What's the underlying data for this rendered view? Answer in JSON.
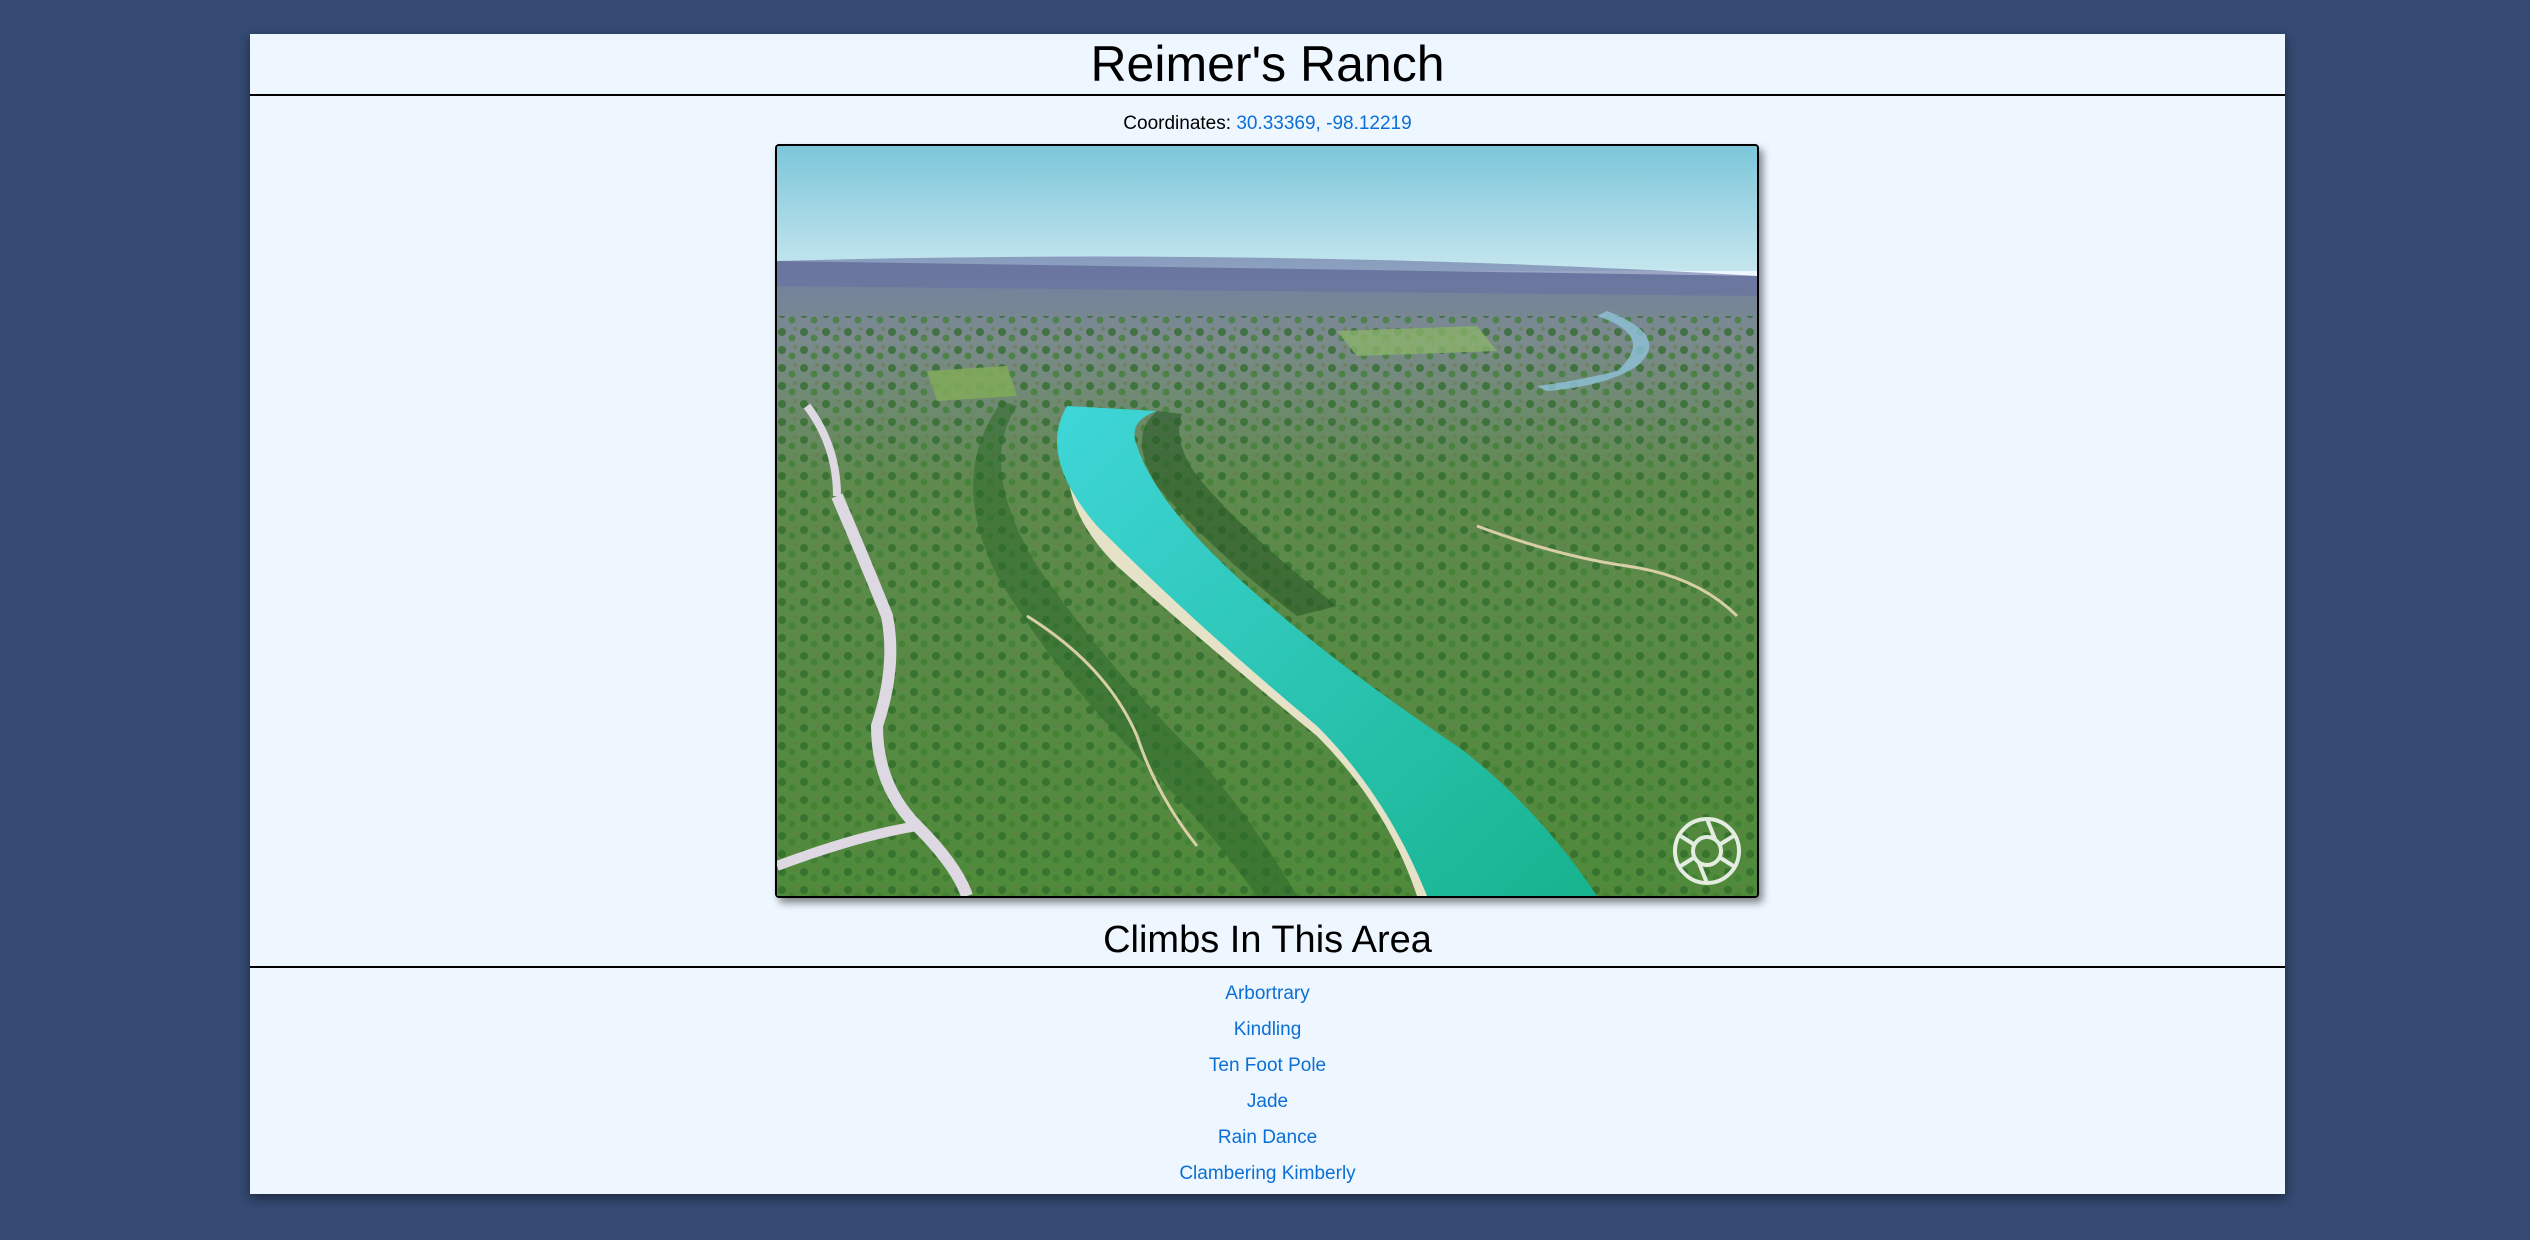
{
  "area": {
    "title": "Reimer's Ranch",
    "coordinates_label": "Coordinates:",
    "coordinates_value": "30.33369, -98.12219"
  },
  "photo": {
    "watermark_icon": "aperture-logo-icon"
  },
  "climbs": {
    "heading": "Climbs In This Area",
    "items": [
      "Arbortrary",
      "Kindling",
      "Ten Foot Pole",
      "Jade",
      "Rain Dance",
      "Clambering Kimberly"
    ]
  },
  "colors": {
    "background": "#344a72",
    "panel": "#eef6ff",
    "link": "#0b6fd6"
  }
}
